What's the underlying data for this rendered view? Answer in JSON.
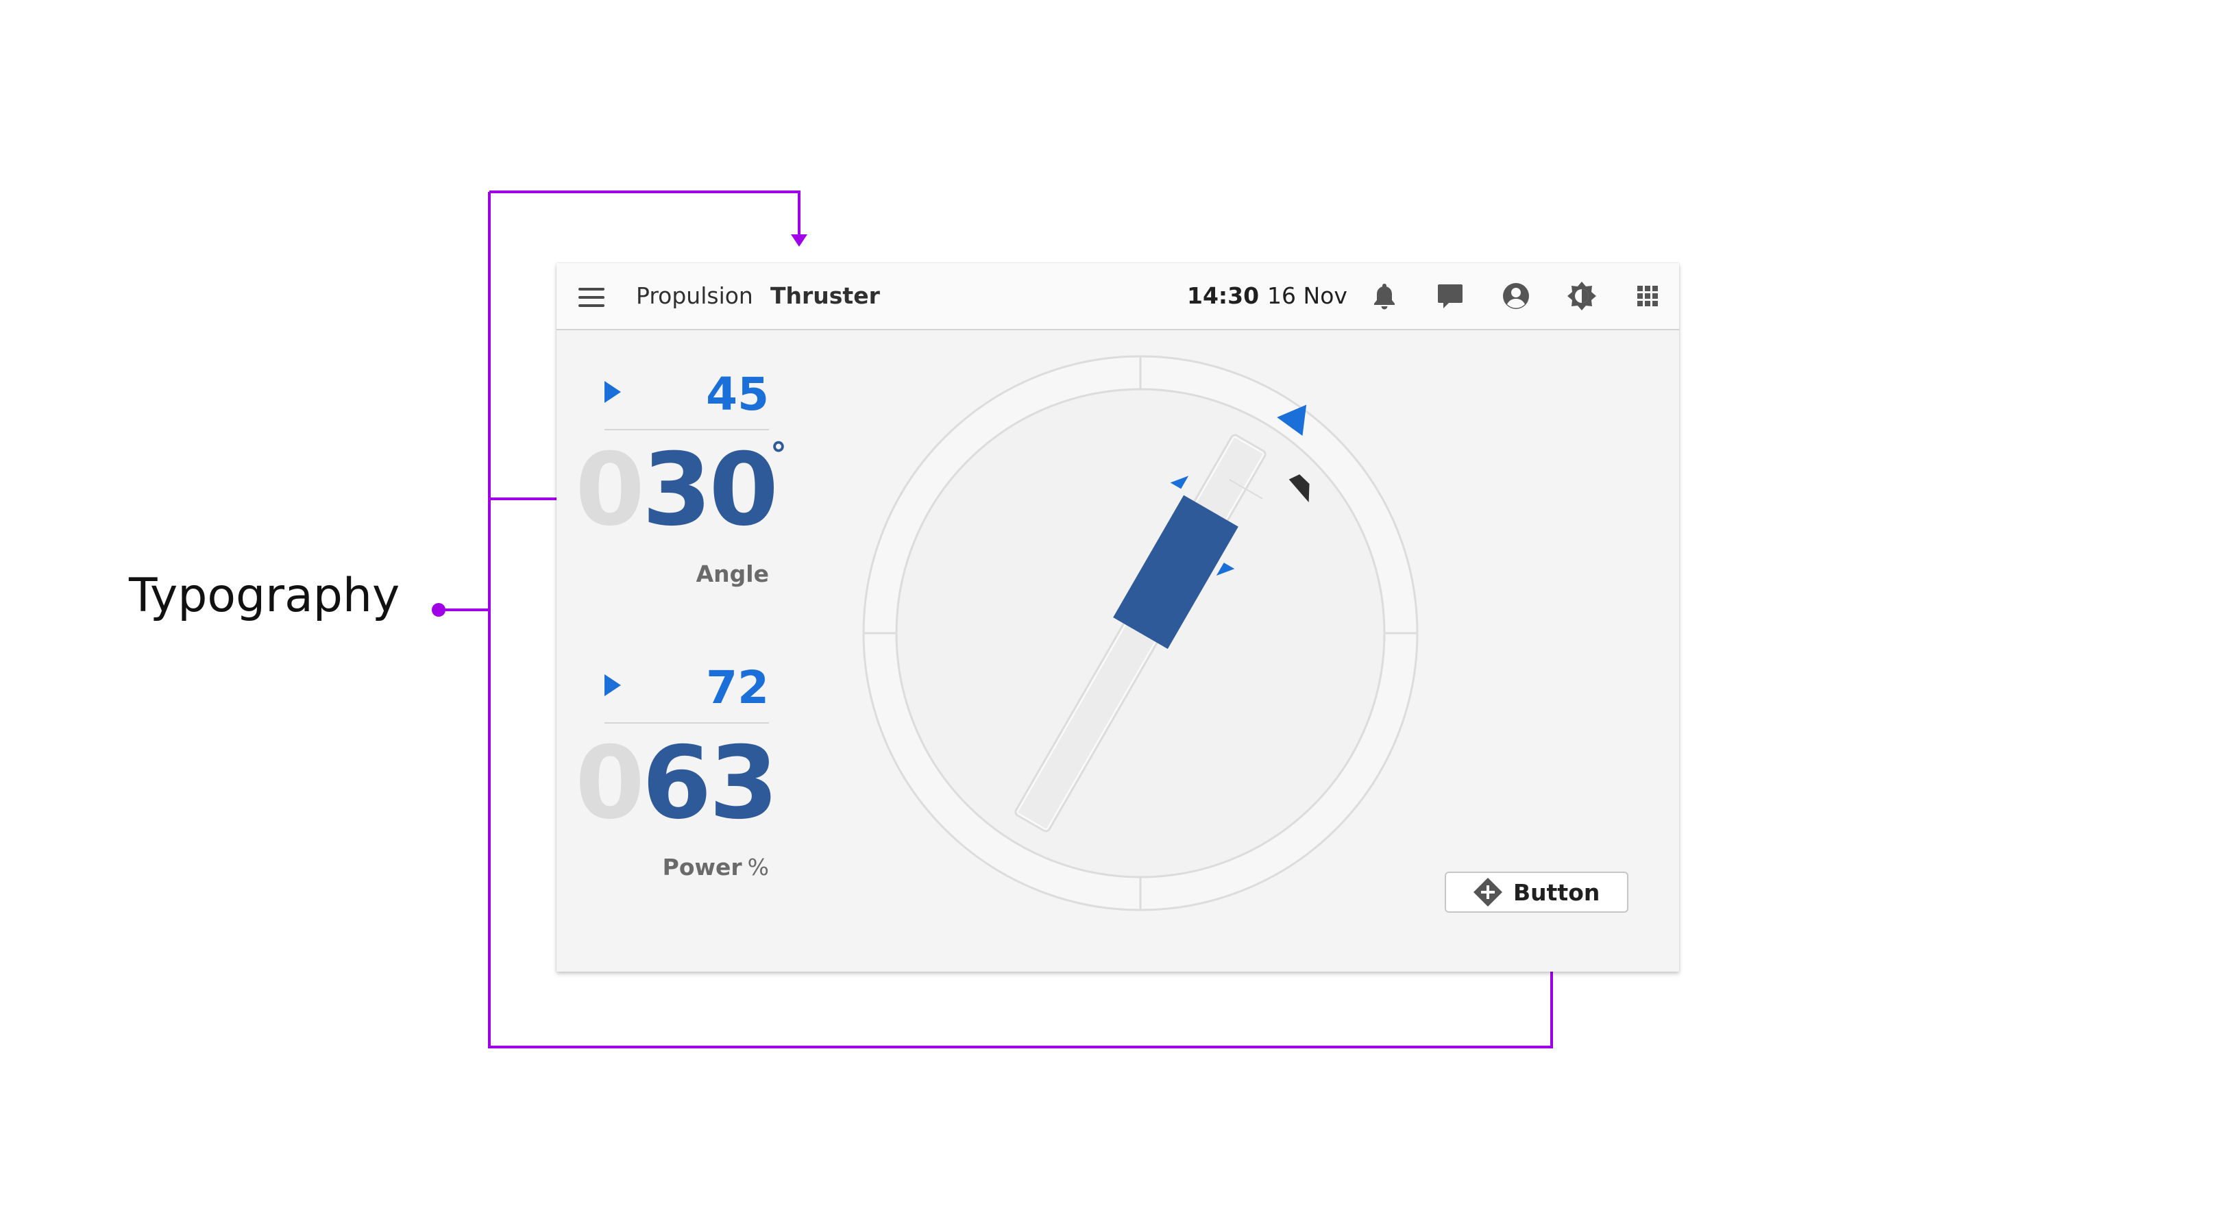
{
  "annotation": {
    "label": "Typography",
    "accent_color": "#a000e8"
  },
  "topbar": {
    "menu_icon": "hamburger-menu-icon",
    "breadcrumb": [
      "Propulsion",
      "Thruster"
    ],
    "time": "14:30",
    "date": "16 Nov",
    "icons": [
      "bell-icon",
      "chat-icon",
      "account-icon",
      "brightness-icon",
      "apps-grid-icon"
    ]
  },
  "angle": {
    "setpoint": "45",
    "lead_digit": "0",
    "value": "30",
    "unit_symbol": "°",
    "label": "Angle"
  },
  "power": {
    "setpoint": "72",
    "lead_digit": "0",
    "value": "63",
    "label": "Power",
    "unit": "%"
  },
  "thruster_dial": {
    "current_angle_deg": 30,
    "setpoint_angle_deg": 45,
    "current_power_pct": 63,
    "setpoint_power_pct": 72,
    "accent_color": "#1a6fd8",
    "value_color": "#2f5a9a"
  },
  "action_button": {
    "icon": "add-diamond-icon",
    "label": "Button"
  }
}
